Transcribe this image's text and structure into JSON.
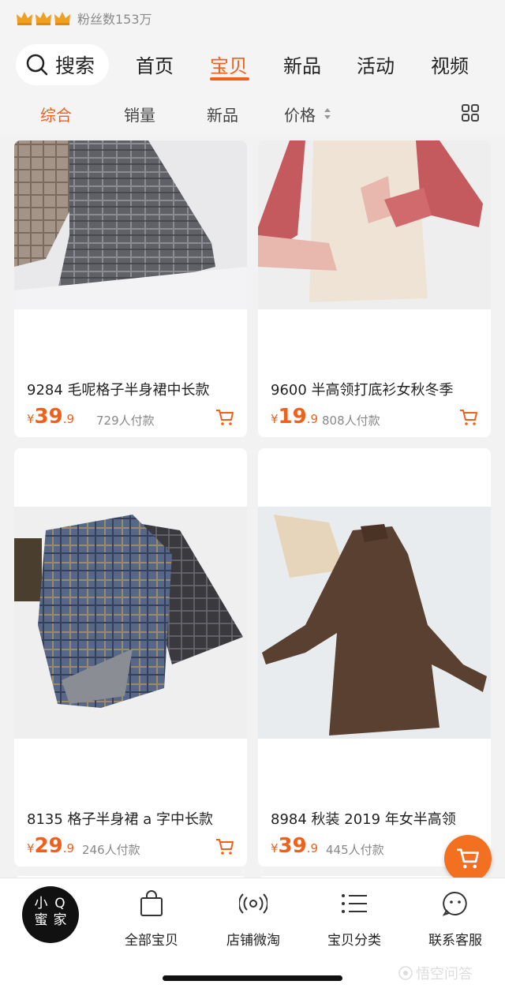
{
  "header": {
    "fans_text": "粉丝数153万"
  },
  "nav": {
    "search_label": "搜索",
    "tabs": [
      "首页",
      "宝贝",
      "新品",
      "活动",
      "视频"
    ],
    "active_tab": "宝贝"
  },
  "sort": {
    "items": [
      "综合",
      "销量",
      "新品",
      "价格"
    ],
    "active": "综合"
  },
  "products": [
    {
      "name": "9284 毛呢格子半身裙中长款",
      "currency": "¥",
      "price_int": "39",
      "price_dec": ".9",
      "sold": "729人付款"
    },
    {
      "name": "9600 半高领打底衫女秋冬季",
      "currency": "¥",
      "price_int": "19",
      "price_dec": ".9",
      "sold": "808人付款"
    },
    {
      "name": "8135 格子半身裙 a 字中长款",
      "currency": "¥",
      "price_int": "29",
      "price_dec": ".9",
      "sold": "246人付款"
    },
    {
      "name": "8984 秋装 2019 年女半高领",
      "currency": "¥",
      "price_int": "39",
      "price_dec": ".9",
      "sold": "445人付款"
    }
  ],
  "bottom_bar": {
    "logo_chars": [
      "小",
      "Q",
      "蜜",
      "家"
    ],
    "items": [
      "全部宝贝",
      "店铺微淘",
      "宝贝分类",
      "联系客服"
    ]
  },
  "watermark": "悟空问答",
  "colors": {
    "accent": "#f0601b",
    "fab": "#f37021"
  }
}
